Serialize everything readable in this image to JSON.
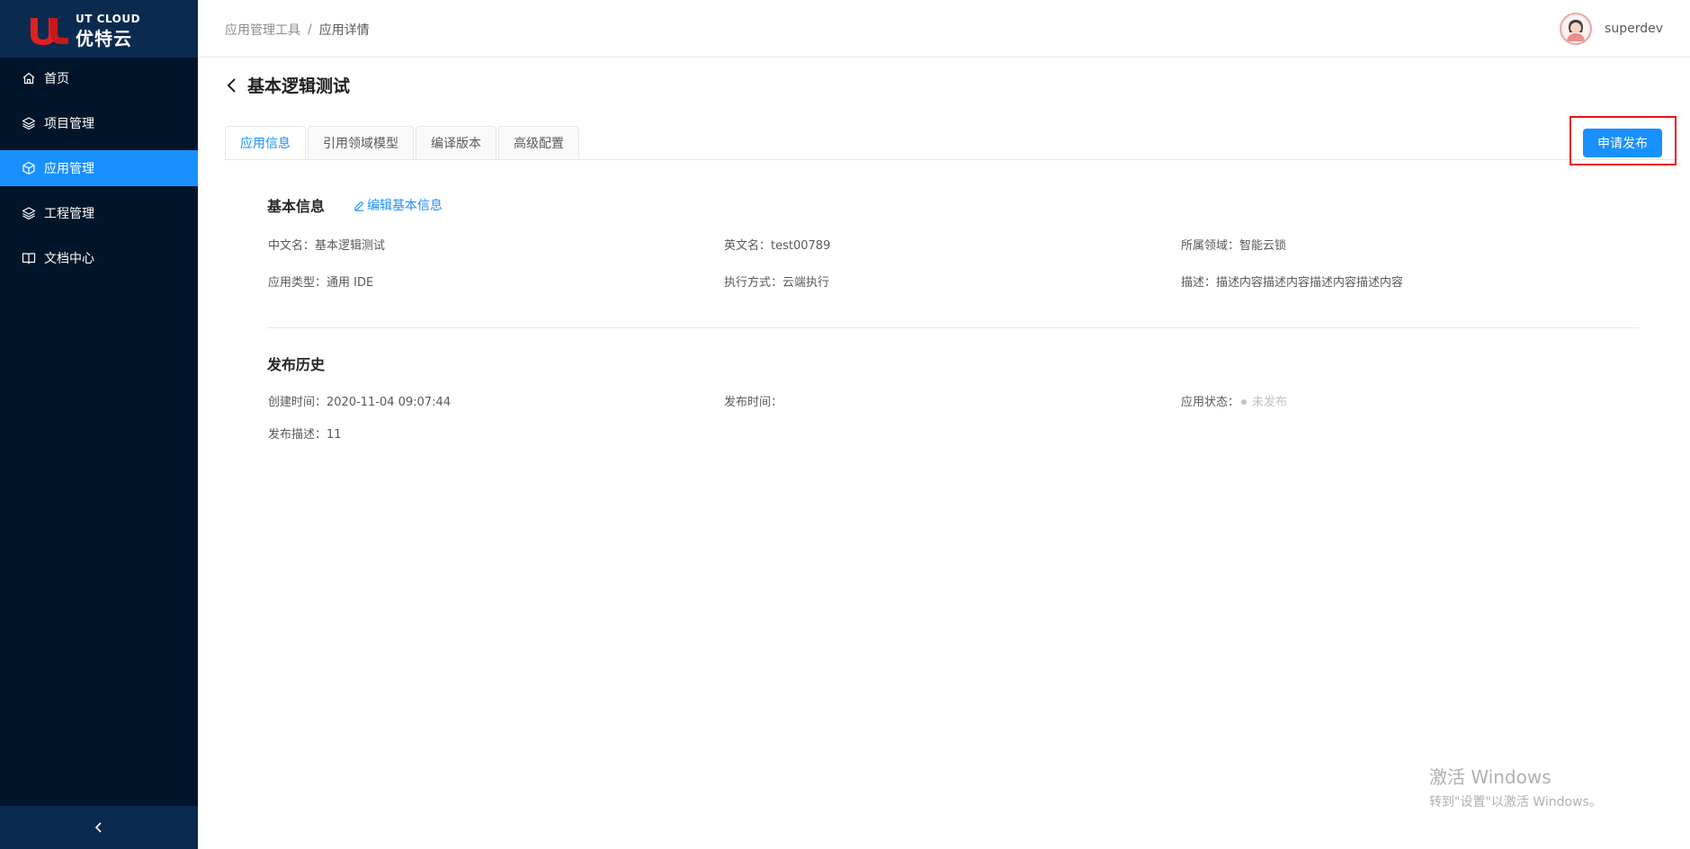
{
  "logo": {
    "en": "UT CLOUD",
    "cn": "优特云"
  },
  "sidebar": {
    "items": [
      {
        "label": "首页",
        "icon": "home-icon"
      },
      {
        "label": "项目管理",
        "icon": "layers-icon"
      },
      {
        "label": "应用管理",
        "icon": "cube-icon",
        "active": true
      },
      {
        "label": "工程管理",
        "icon": "layers-icon"
      },
      {
        "label": "文档中心",
        "icon": "book-icon"
      }
    ],
    "collapse_icon": "chevron-left-icon"
  },
  "header": {
    "breadcrumb": [
      "应用管理工具",
      "应用详情"
    ],
    "breadcrumb_sep": "/",
    "username": "superdev"
  },
  "page": {
    "title": "基本逻辑测试",
    "tabs": [
      "应用信息",
      "引用领域模型",
      "编译版本",
      "高级配置"
    ],
    "active_tab": 0,
    "publish_button": "申请发布"
  },
  "basic_info": {
    "title": "基本信息",
    "edit_link": "编辑基本信息",
    "fields": [
      {
        "label": "中文名：",
        "value": "基本逻辑测试"
      },
      {
        "label": "英文名：",
        "value": "test00789"
      },
      {
        "label": "所属领域：",
        "value": "智能云锁"
      },
      {
        "label": "应用类型：",
        "value": "通用 IDE"
      },
      {
        "label": "执行方式：",
        "value": "云端执行"
      },
      {
        "label": "描述：",
        "value": "描述内容描述内容描述内容描述内容"
      }
    ]
  },
  "publish_history": {
    "title": "发布历史",
    "fields": [
      {
        "label": "创建时间：",
        "value": "2020-11-04 09:07:44"
      },
      {
        "label": "发布时间：",
        "value": ""
      },
      {
        "label": "应用状态：",
        "value": "未发布"
      },
      {
        "label": "发布描述：",
        "value": "11"
      }
    ]
  },
  "watermark": {
    "line1": "激活 Windows",
    "line2": "转到\"设置\"以激活 Windows。"
  },
  "colors": {
    "sidebar_bg": "#001529",
    "accent": "#1890ff",
    "highlight": "#ee1111"
  }
}
